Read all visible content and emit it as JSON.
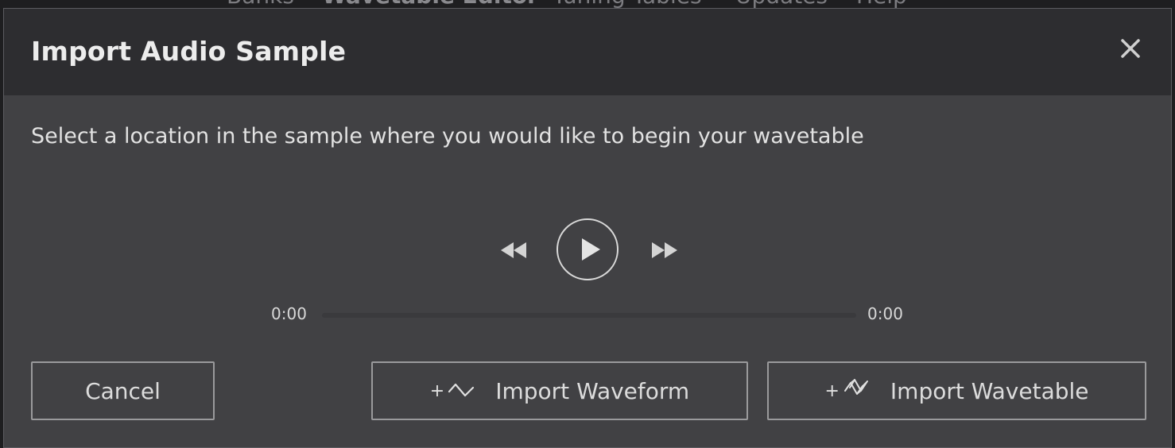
{
  "background_nav": {
    "items": [
      "Banks",
      "Wavetable Editor",
      "Tuning Tables",
      "Updates",
      "Help"
    ]
  },
  "dialog": {
    "title": "Import Audio Sample",
    "close_icon": "close-icon",
    "instruction": "Select a location in the sample where you would like to begin your wavetable",
    "transport": {
      "rewind_icon": "rewind-icon",
      "play_icon": "play-icon",
      "fast_forward_icon": "fast-forward-icon",
      "time_current": "0:00",
      "time_total": "0:00",
      "progress": 0
    },
    "buttons": {
      "cancel": "Cancel",
      "import_waveform_prefix": "+",
      "import_waveform": "Import Waveform",
      "import_waveform_icon": "waveform-icon",
      "import_wavetable_prefix": "+",
      "import_wavetable": "Import Wavetable",
      "import_wavetable_icon": "wavetable-icon"
    }
  },
  "colors": {
    "dialog_body": "#414144",
    "dialog_header": "#2d2d30",
    "text": "#e2e2e2",
    "button_border": "#9a9a9c"
  }
}
